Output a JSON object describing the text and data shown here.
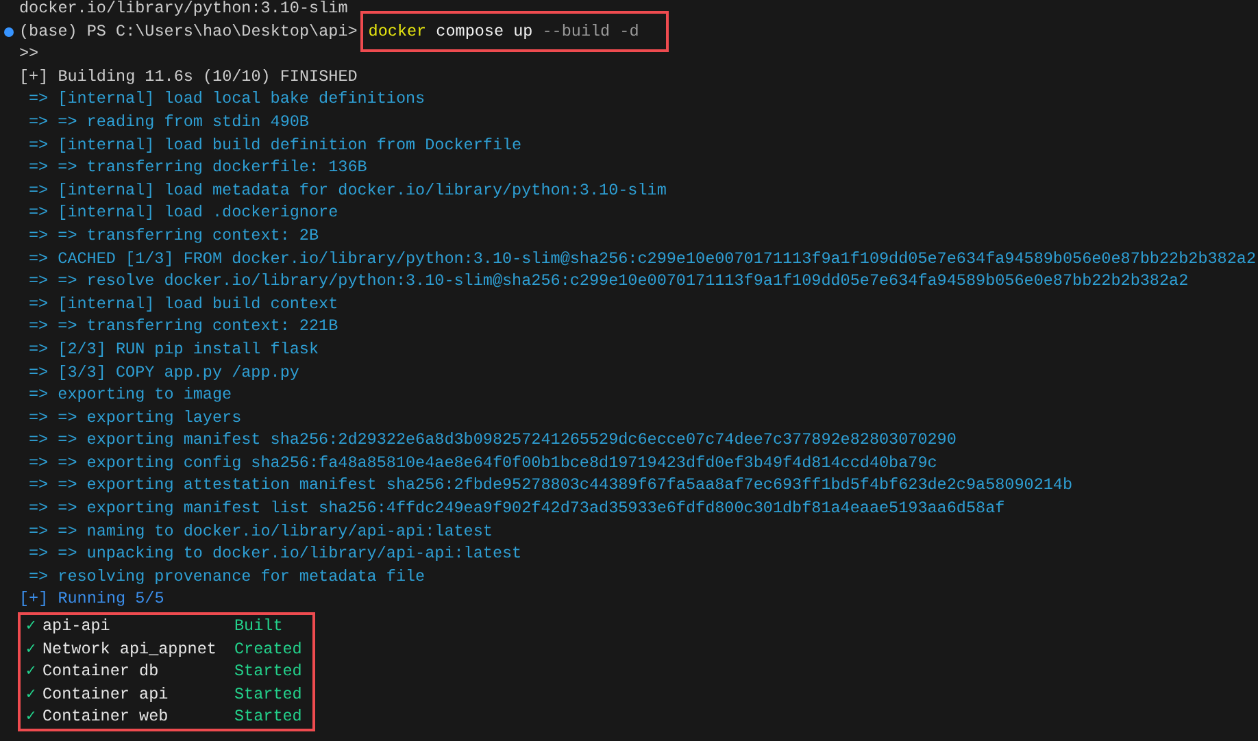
{
  "terminal": {
    "lines": [
      {
        "kind": "output",
        "text": "docker.io/library/python:3.10-slim"
      },
      {
        "kind": "prompt",
        "text": "(base) PS C:\\Users\\hao\\Desktop\\api>",
        "command": [
          {
            "kind": "program",
            "text": "docker"
          },
          {
            "kind": "word",
            "text": "compose up"
          },
          {
            "kind": "flag",
            "text": "--build -d"
          }
        ],
        "highlighted": true
      },
      {
        "kind": "continuation",
        "text": ">>"
      },
      {
        "kind": "header",
        "text": "[+] Building 11.6s (10/10) FINISHED"
      },
      {
        "kind": "step",
        "text": "=> [internal] load local bake definitions"
      },
      {
        "kind": "step",
        "text": "=> => reading from stdin 490B"
      },
      {
        "kind": "step",
        "text": "=> [internal] load build definition from Dockerfile"
      },
      {
        "kind": "step",
        "text": "=> => transferring dockerfile: 136B"
      },
      {
        "kind": "step",
        "text": "=> [internal] load metadata for docker.io/library/python:3.10-slim"
      },
      {
        "kind": "step",
        "text": "=> [internal] load .dockerignore"
      },
      {
        "kind": "step",
        "text": "=> => transferring context: 2B"
      },
      {
        "kind": "step",
        "text": "=> CACHED [1/3] FROM docker.io/library/python:3.10-slim@sha256:c299e10e0070171113f9a1f109dd05e7e634fa94589b056e0e87bb22b2b382a2"
      },
      {
        "kind": "step",
        "text": "=> => resolve docker.io/library/python:3.10-slim@sha256:c299e10e0070171113f9a1f109dd05e7e634fa94589b056e0e87bb22b2b382a2"
      },
      {
        "kind": "step",
        "text": "=> [internal] load build context"
      },
      {
        "kind": "step",
        "text": "=> => transferring context: 221B"
      },
      {
        "kind": "step",
        "text": "=> [2/3] RUN pip install flask"
      },
      {
        "kind": "step",
        "text": "=> [3/3] COPY app.py /app.py"
      },
      {
        "kind": "step",
        "text": "=> exporting to image"
      },
      {
        "kind": "step",
        "text": "=> => exporting layers"
      },
      {
        "kind": "step",
        "text": "=> => exporting manifest sha256:2d29322e6a8d3b098257241265529dc6ecce07c74dee7c377892e82803070290"
      },
      {
        "kind": "step",
        "text": "=> => exporting config sha256:fa48a85810e4ae8e64f0f00b1bce8d19719423dfd0ef3b49f4d814ccd40ba79c"
      },
      {
        "kind": "step",
        "text": "=> => exporting attestation manifest sha256:2fbde95278803c44389f67fa5aa8af7ec693ff1bd5f4bf623de2c9a58090214b"
      },
      {
        "kind": "step",
        "text": "=> => exporting manifest list sha256:4ffdc249ea9f902f42d73ad35933e6fdfd800c301dbf81a4eaae5193aa6d58af"
      },
      {
        "kind": "step",
        "text": "=> => naming to docker.io/library/api-api:latest"
      },
      {
        "kind": "step",
        "text": "=> => unpacking to docker.io/library/api-api:latest"
      },
      {
        "kind": "step",
        "text": "=> resolving provenance for metadata file"
      },
      {
        "kind": "running",
        "text": "[+] Running 5/5"
      }
    ],
    "services_highlighted": true,
    "services": [
      {
        "mark": "✓",
        "name": "api-api",
        "status": "Built"
      },
      {
        "mark": "✓",
        "name": "Network api_appnet",
        "status": "Created"
      },
      {
        "mark": "✓",
        "name": "Container db",
        "status": "Started"
      },
      {
        "mark": "✓",
        "name": "Container api",
        "status": "Started"
      },
      {
        "mark": "✓",
        "name": "Container web",
        "status": "Started"
      }
    ]
  }
}
